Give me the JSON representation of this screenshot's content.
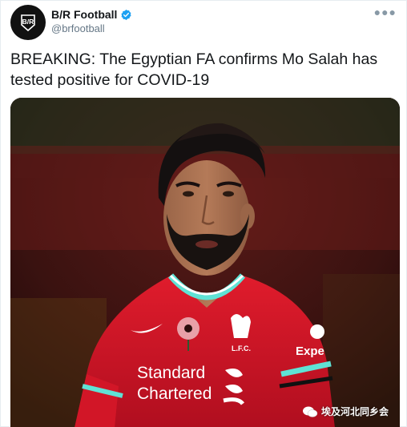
{
  "author": {
    "name": "B/R Football",
    "handle": "@brfootball",
    "verified": true,
    "avatar_text": "B/R"
  },
  "tweet": {
    "text": "BREAKING: The Egyptian FA confirms Mo Salah has tested positive for COVID-19"
  },
  "more_icon": "more-icon",
  "media": {
    "kit_sponsor_line1": "Standard",
    "kit_sponsor_line2": "Chartered",
    "kit_sleeve_sponsor": "Expe",
    "crest_text": "L.F.C.",
    "shirt_color": "#c8102e"
  },
  "watermark": {
    "text": "埃及河北同乡会"
  },
  "colors": {
    "verified": "#1da1f2",
    "text": "#14171a",
    "secondary": "#657786"
  }
}
